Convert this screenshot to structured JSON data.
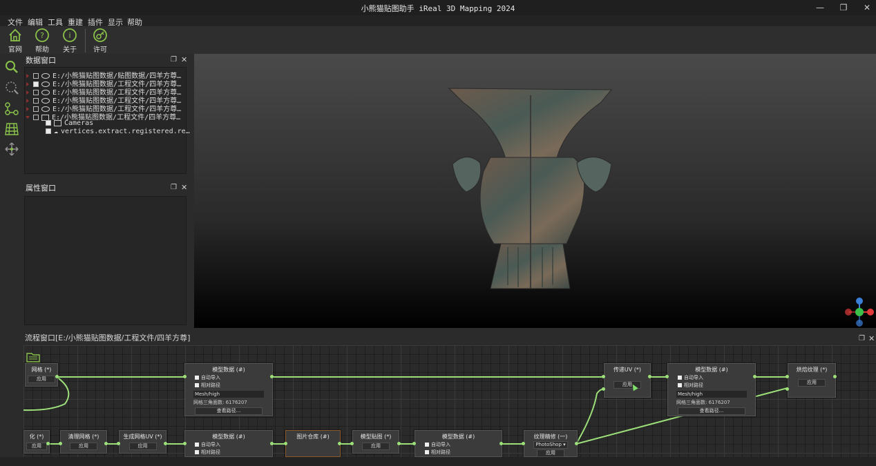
{
  "window": {
    "title": "小熊猫贴图助手 iReal 3D Mapping 2024"
  },
  "menu": [
    "文件",
    "编辑",
    "工具",
    "重建",
    "插件",
    "显示",
    "帮助"
  ],
  "toolbar": {
    "home": "官网",
    "help": "帮助",
    "about": "关于",
    "license": "许可"
  },
  "data_panel": {
    "title": "数据窗口",
    "rows": [
      "E:/小熊猫贴图数据/贴图数据/四羊方尊…",
      "E:/小熊猫贴图数据/工程文件/四羊方尊…",
      "E:/小熊猫贴图数据/工程文件/四羊方尊…",
      "E:/小熊猫贴图数据/工程文件/四羊方尊…",
      "E:/小熊猫贴图数据/工程文件/四羊方尊…",
      "E:/小熊猫贴图数据/工程文件/四羊方尊…"
    ],
    "children": [
      "Cameras",
      "vertices.extract.registered.re…"
    ]
  },
  "prop_panel": {
    "title": "属性窗口"
  },
  "flow_panel": {
    "title": "流程窗口[E:/小熊猫贴图数据/工程文件/四羊方尊]"
  },
  "nodes": {
    "grid": {
      "title": "网格 (*)",
      "btn": "应用"
    },
    "model1": {
      "title": "模型数据 (#)",
      "auto": "自动导入",
      "rel": "相对路径",
      "field": "Mesh/high",
      "info": "网格三角面数: 6176207",
      "btn": "查看路径..."
    },
    "uv_pass": {
      "title": "传递UV (*)",
      "btn": "应用"
    },
    "model2": {
      "title": "模型数据 (#)",
      "auto": "自动导入",
      "rel": "相对路径",
      "field": "Mesh/high",
      "info": "网格三角面数: 6176207",
      "btn": "查看路径..."
    },
    "bake": {
      "title": "烘焙纹理 (*)",
      "btn": "应用"
    },
    "n_simplify": {
      "title": "化 (*)",
      "btn": "应用"
    },
    "n_clean": {
      "title": "清理网格 (*)",
      "btn": "应用"
    },
    "n_uv": {
      "title": "生成网格UV (*)",
      "btn": "应用"
    },
    "n_model3": {
      "title": "模型数据 (#)",
      "auto": "自动导入",
      "rel": "相对路径"
    },
    "n_images": {
      "title": "图片仓库 (#)"
    },
    "n_mapping": {
      "title": "模型贴图 (*)",
      "btn": "应用"
    },
    "n_model4": {
      "title": "模型数据 (#)",
      "auto": "自动导入",
      "rel": "相对路径"
    },
    "n_texedit": {
      "title": "纹理精修 (一)",
      "select": "PhotoShop",
      "btn": "应用"
    }
  },
  "colors": {
    "accent": "#3a8fd4",
    "link": "#9de07a",
    "axis_x": "#e03a3a",
    "axis_y": "#3ac04a",
    "axis_z": "#3a7fd8"
  }
}
